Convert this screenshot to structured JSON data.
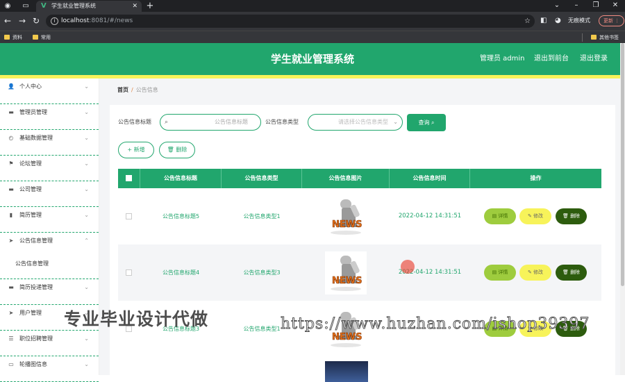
{
  "browser": {
    "tab_title": "学生就业管理系统",
    "url_host": "localhost",
    "url_rest": ":8081/#/news",
    "profile_label": "无痕模式",
    "update_label": "更新",
    "bookmarks": [
      "资料",
      "常用"
    ],
    "other_bookmarks": "其他书签"
  },
  "header": {
    "title": "学生就业管理系统",
    "admin": "管理员 admin",
    "back_front": "退出到前台",
    "logout": "退出登录"
  },
  "sidebar": {
    "items": [
      {
        "label": "个人中心",
        "icon": "user-icon"
      },
      {
        "label": "管理员管理",
        "icon": "monitor-icon"
      },
      {
        "label": "基础数据管理",
        "icon": "compass-icon"
      },
      {
        "label": "论坛管理",
        "icon": "flag-icon"
      },
      {
        "label": "公司管理",
        "icon": "monitor-icon"
      },
      {
        "label": "简历管理",
        "icon": "chart-icon"
      },
      {
        "label": "公告信息管理",
        "icon": "send-icon"
      },
      {
        "label": "简历投递管理",
        "icon": "monitor-icon"
      },
      {
        "label": "用户管理",
        "icon": "send-icon"
      },
      {
        "label": "职位招聘管理",
        "icon": "list-icon"
      },
      {
        "label": "轮播图信息",
        "icon": "chat-icon"
      }
    ],
    "subitem": "公告信息管理"
  },
  "breadcrumb": {
    "home": "首页",
    "current": "公告信息"
  },
  "filters": {
    "title_label": "公告信息标题",
    "title_placeholder": "公告信息标题",
    "type_label": "公告信息类型",
    "type_placeholder": "请选择公告信息类型",
    "query_label": "查询"
  },
  "actions": {
    "add": "新增",
    "delete": "删除"
  },
  "table": {
    "headers": [
      "公告信息标题",
      "公告信息类型",
      "公告信息图片",
      "公告信息时间",
      "操作"
    ],
    "rows": [
      {
        "title": "公告信息标题5",
        "type": "公告信息类型1",
        "time": "2022-04-12 14:31:51"
      },
      {
        "title": "公告信息标题4",
        "type": "公告信息类型3",
        "time": "2022-04-12 14:31:51"
      },
      {
        "title": "公告信息标题3",
        "type": "公告信息类型1",
        "time": ""
      }
    ],
    "row_actions": {
      "detail": "详情",
      "edit": "修改",
      "delete": "删除"
    },
    "image_text": "NEWS"
  },
  "watermark": {
    "text": "专业毕业设计代做",
    "url": "https://www.huzhan.com/ishop39397"
  },
  "colors": {
    "primary": "#21a66d",
    "accent_yellow": "#f7f35a",
    "detail": "#9ecc3e",
    "delete": "#2d5c0e"
  }
}
